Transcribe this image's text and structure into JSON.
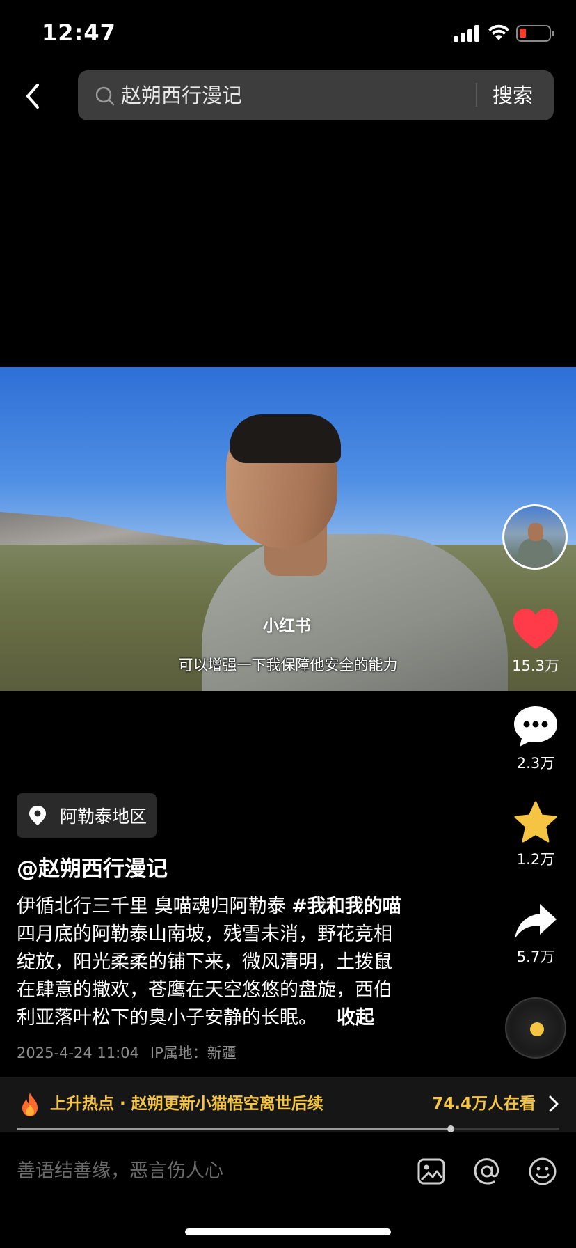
{
  "status_bar": {
    "time": "12:47"
  },
  "search": {
    "query": "赵朔西行漫记",
    "button_label": "搜索"
  },
  "video": {
    "watermark": "小红书",
    "subtitle": "可以增强一下我保障他安全的能力",
    "progress": 0.8
  },
  "actions": {
    "like_count": "15.3万",
    "comment_count": "2.3万",
    "favorite_count": "1.2万",
    "share_count": "5.7万"
  },
  "post": {
    "location": "阿勒泰地区",
    "author": "@赵朔西行漫记",
    "desc_lines": [
      "伊循北行三千里 臭喵魂归阿勒泰 ",
      "四月底的阿勒泰山南坡，残雪未消，野花竞相",
      "绽放，阳光柔柔的铺下来，微风清明，土拨鼠",
      "在肆意的撒欢，苍鹰在天空悠悠的盘旋，西伯",
      "利亚落叶松下的臭小子安静的长眠。"
    ],
    "hashtag": "#我和我的喵",
    "collapse_label": "收起",
    "date": "2025-4-24 11:04",
    "ip_location": "IP属地：新疆"
  },
  "hot": {
    "text": "上升热点 · 赵朔更新小猫悟空离世后续",
    "viewers": "74.4万人在看"
  },
  "comment_bar": {
    "placeholder": "善语结善缘，恶言伤人心"
  },
  "colors": {
    "like": "#ff3b49",
    "favorite": "#f5c442",
    "hot": "#f5c442"
  },
  "icons": [
    "back-icon",
    "search-icon",
    "heart-icon",
    "comment-icon",
    "star-icon",
    "share-icon",
    "location-pin-icon",
    "fire-icon",
    "chevron-right-icon",
    "image-icon",
    "at-icon",
    "emoji-icon"
  ]
}
